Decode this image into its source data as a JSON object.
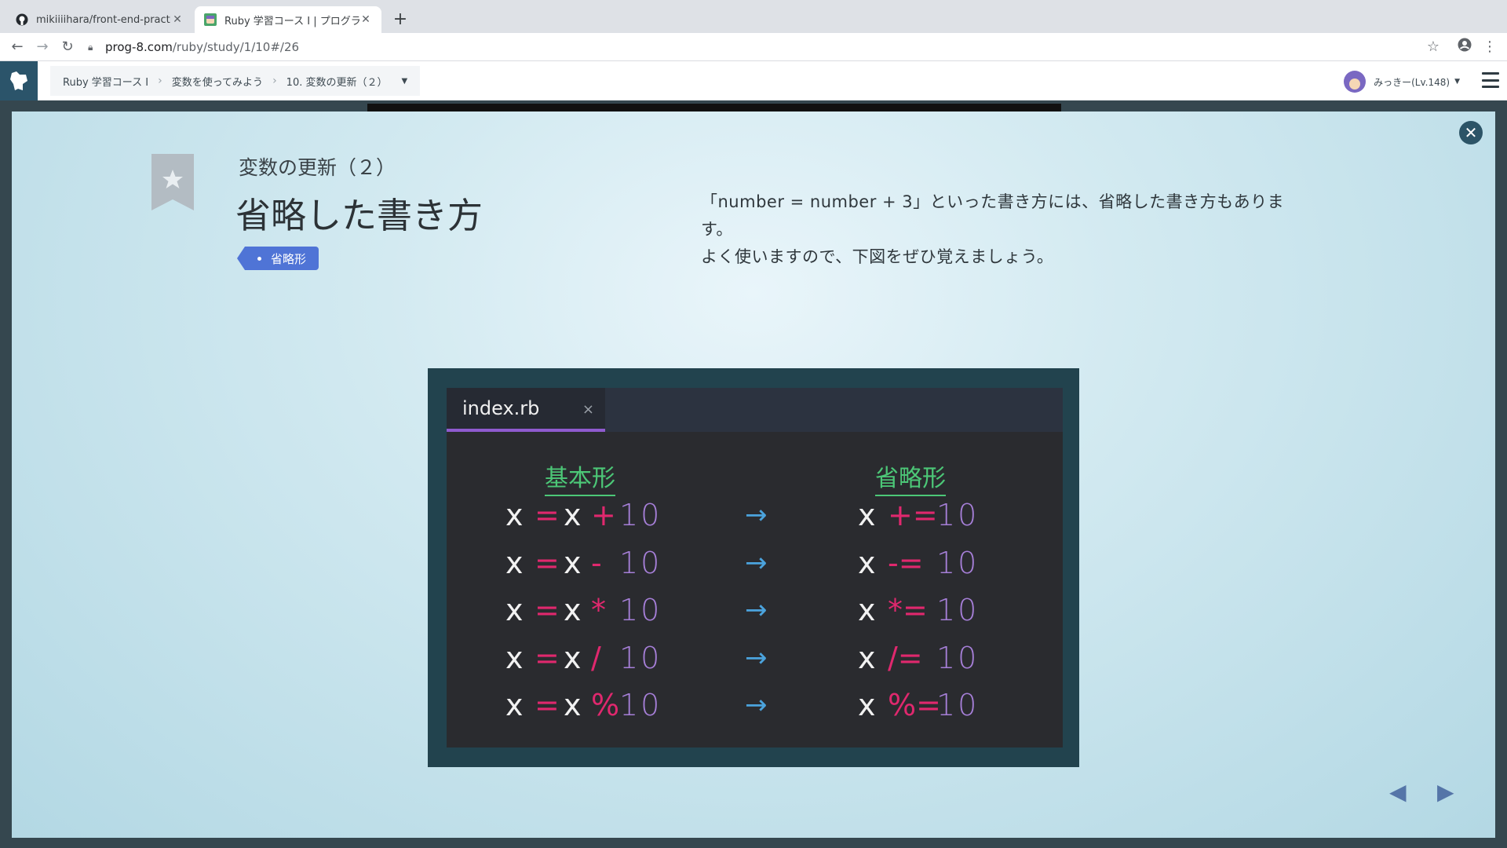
{
  "browser": {
    "tabs": [
      {
        "title": "mikiiiihara/front-end-practice",
        "active": false
      },
      {
        "title": "Ruby 学習コース I | プログラミング",
        "active": true
      }
    ],
    "url_host": "prog-8.com",
    "url_path": "/ruby/study/1/10#/26"
  },
  "header": {
    "breadcrumb": [
      "Ruby 学習コース Ⅰ",
      "変数を使ってみよう",
      "10. 変数の更新（２）"
    ],
    "user_name": "みっきー(Lv.148)"
  },
  "lesson": {
    "subtitle": "変数の更新（２）",
    "title": "省略した書き方",
    "tag": "省略形",
    "description_line1": "「number = number + 3」といった書き方には、省略した書き方もありま",
    "description_line2": "す。",
    "description_line3": "よく使いますので、下図をぜひ覚えましょう。"
  },
  "editor": {
    "file_name": "index.rb",
    "close_glyph": "×",
    "basic_heading": "基本形",
    "short_heading": "省略形",
    "rows": [
      {
        "basic_op": "+",
        "short_op": "+=",
        "value": "10"
      },
      {
        "basic_op": "-",
        "short_op": "-=",
        "value": "10"
      },
      {
        "basic_op": "*",
        "short_op": "*=",
        "value": "10"
      },
      {
        "basic_op": "/",
        "short_op": "/=",
        "value": "10"
      },
      {
        "basic_op": "%",
        "short_op": "%=",
        "value": "10"
      }
    ],
    "var": "x",
    "assign": "=",
    "arrow": "→"
  },
  "colors": {
    "accent_tag": "#4f74d6",
    "code_operator": "#e0286e",
    "code_number": "#a67fd8",
    "code_heading": "#4cc777",
    "code_arrow": "#4ba3dd"
  }
}
